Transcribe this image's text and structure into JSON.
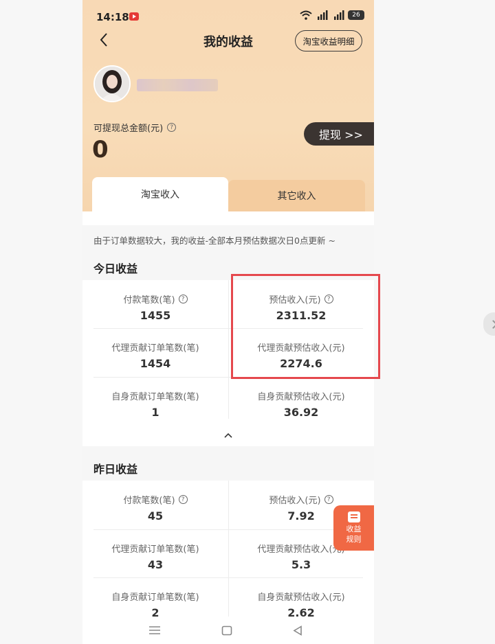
{
  "status_bar": {
    "time": "14:18",
    "battery": "26"
  },
  "header": {
    "title": "我的收益",
    "detail_button": "淘宝收益明细"
  },
  "account": {
    "balance_label": "可提现总金额(元)",
    "balance": "0",
    "withdraw_label": "提现 >>"
  },
  "tabs": [
    {
      "label": "淘宝收入",
      "active": true
    },
    {
      "label": "其它收入",
      "active": false
    }
  ],
  "notice": "由于订单数据较大，我的收益-全部本月预估数据次日0点更新 ~",
  "today": {
    "title": "今日收益",
    "items": [
      {
        "label": "付款笔数(笔)",
        "value": "1455",
        "help": true
      },
      {
        "label": "预估收入(元)",
        "value": "2311.52",
        "help": true
      },
      {
        "label": "代理贡献订单笔数(笔)",
        "value": "1454"
      },
      {
        "label": "代理贡献预估收入(元)",
        "value": "2274.6"
      },
      {
        "label": "自身贡献订单笔数(笔)",
        "value": "1"
      },
      {
        "label": "自身贡献预估收入(元)",
        "value": "36.92"
      }
    ]
  },
  "yesterday": {
    "title": "昨日收益",
    "items": [
      {
        "label": "付款笔数(笔)",
        "value": "45",
        "help": true
      },
      {
        "label": "预估收入(元)",
        "value": "7.92",
        "help": true
      },
      {
        "label": "代理贡献订单笔数(笔)",
        "value": "43"
      },
      {
        "label": "代理贡献预估收入(元)",
        "value": "5.3"
      },
      {
        "label": "自身贡献订单笔数(笔)",
        "value": "2"
      },
      {
        "label": "自身贡献预估收入(元)",
        "value": "2.62"
      }
    ]
  },
  "rules_button": {
    "line1": "收益",
    "line2": "规则"
  },
  "help_glyph": "?",
  "icons": {
    "back": "chevron-left-icon",
    "collapse": "chevron-up-icon",
    "menu": "menu-icon",
    "home": "home-icon",
    "nav_back": "triangle-back-icon"
  },
  "colors": {
    "hero": "#f8d9b5",
    "tab_inactive": "#f4cc9f",
    "withdraw": "#3b3431",
    "rules": "#f06844",
    "highlight": "#e5484d"
  }
}
